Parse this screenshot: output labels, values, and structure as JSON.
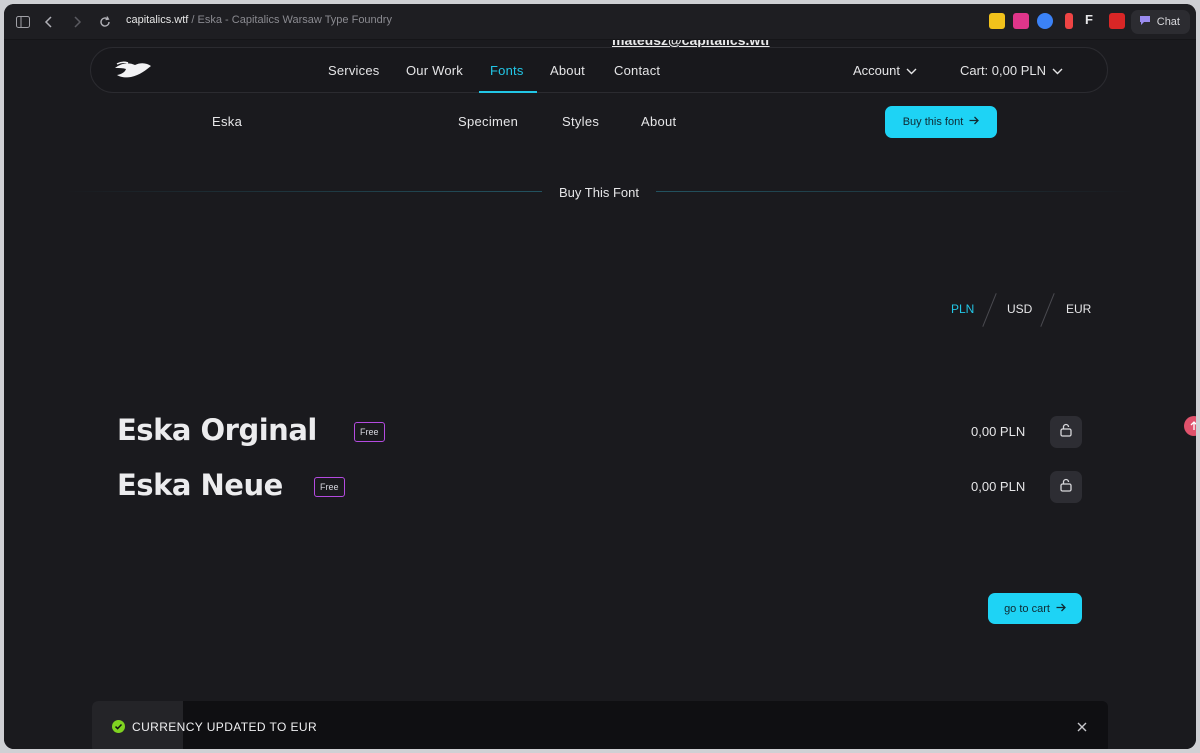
{
  "browser": {
    "domain": "capitalics.wtf",
    "title": "Eska - Capitalics Warsaw Type Foundry",
    "chat_label": "Chat"
  },
  "header": {
    "email_peek": "mateusz@capitalics.wtf",
    "nav": [
      "Services",
      "Our Work",
      "Fonts",
      "About",
      "Contact"
    ],
    "active_nav": "Fonts",
    "account_label": "Account",
    "cart_label": "Cart: 0,00 PLN"
  },
  "subnav": {
    "font_name": "Eska",
    "items": [
      "Specimen",
      "Styles",
      "About"
    ],
    "buy_label": "Buy this font"
  },
  "section": {
    "title": "Buy This Font"
  },
  "currency": {
    "options": [
      "PLN",
      "USD",
      "EUR"
    ],
    "active": "PLN"
  },
  "fonts": [
    {
      "name": "Eska Orginal",
      "badge": "Free",
      "price": "0,00 PLN"
    },
    {
      "name": "Eska Neue",
      "badge": "Free",
      "price": "0,00 PLN"
    }
  ],
  "cart_button": "go to cart",
  "toast": {
    "message": "CURRENCY UPDATED TO EUR",
    "progress": 0.09
  },
  "colors": {
    "accent": "#1ed3f5",
    "badge_border": "#b44be0",
    "success": "#7fd321"
  }
}
